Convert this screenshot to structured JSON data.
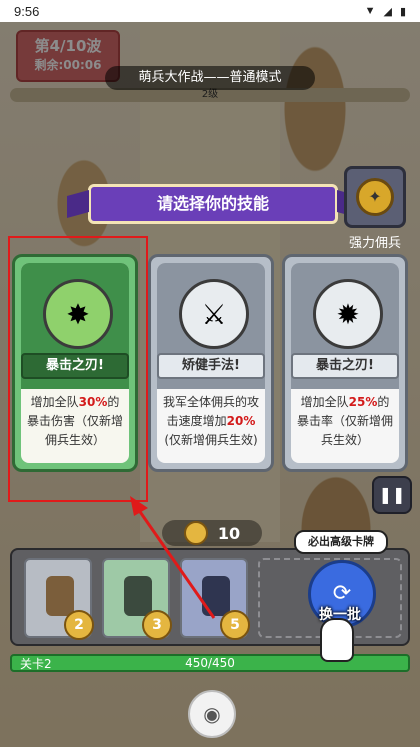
{
  "status_bar": {
    "time": "9:56",
    "icons": [
      "signal-icon",
      "wifi-icon",
      "battery-icon"
    ]
  },
  "hud": {
    "wave": "第4/10波",
    "remaining": "剩余:00:06",
    "mode_title": "萌兵大作战——普通模式",
    "level_label": "2级"
  },
  "banner": {
    "title": "请选择你的技能"
  },
  "mercenary": {
    "label": "强力佣兵"
  },
  "cards": [
    {
      "name": "暴击之刃!",
      "desc_pre": "增加全队",
      "desc_hl": "30%",
      "desc_post": "的暴击伤害（仅新增佣兵生效）",
      "icon": "explosion-icon"
    },
    {
      "name": "矫健手法!",
      "desc_pre": "我军全体佣兵的攻击速度增加",
      "desc_hl": "20%",
      "desc_post": "(仅新增佣兵生效)",
      "icon": "sword-icon"
    },
    {
      "name": "暴击之刃!",
      "desc_pre": "增加全队",
      "desc_hl": "25%",
      "desc_post": "的暴击率（仅新增佣兵生效）",
      "icon": "burst-icon"
    }
  ],
  "cost": {
    "value": "10"
  },
  "tray": {
    "slots": [
      {
        "num": "2"
      },
      {
        "num": "3"
      },
      {
        "num": "5"
      }
    ],
    "reroll_badge": "必出高级卡牌",
    "reroll_label": "换一批"
  },
  "progress": {
    "stage": "关卡2",
    "hp": "450/450",
    "fill": 1.0
  },
  "colors": {
    "highlight": "#e01a1a",
    "banner": "#6a3fb8",
    "card_green": "#3f8f4a"
  }
}
